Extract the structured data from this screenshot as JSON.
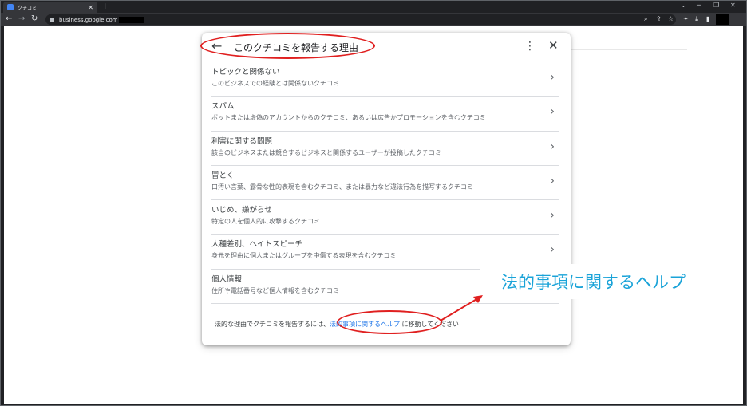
{
  "browser": {
    "tab_title": "クチコミ",
    "tab_close": "✕",
    "new_tab": "+",
    "url": "business.google.com",
    "window_controls": [
      "⌄",
      "─",
      "❐",
      "✕"
    ]
  },
  "dialog": {
    "title": "このクチコミを報告する理由",
    "reasons": [
      {
        "title": "トピックと関係ない",
        "desc": "このビジネスでの経験とは関係ないクチコミ",
        "has_chevron": true
      },
      {
        "title": "スパム",
        "desc": "ボットまたは虚偽のアカウントからのクチコミ、あるいは広告かプロモーションを含むクチコミ",
        "has_chevron": true
      },
      {
        "title": "利害に関する問題",
        "desc": "該当のビジネスまたは競合するビジネスと関係するユーザーが投稿したクチコミ",
        "has_chevron": true
      },
      {
        "title": "冒とく",
        "desc": "口汚い言葉、露骨な性的表現を含むクチコミ、または暴力など違法行為を描写するクチコミ",
        "has_chevron": true
      },
      {
        "title": "いじめ、嫌がらせ",
        "desc": "特定の人を個人的に攻撃するクチコミ",
        "has_chevron": true
      },
      {
        "title": "人種差別、ヘイトスピーチ",
        "desc": "身元を理由に個人またはグループを中傷する表現を含むクチコミ",
        "has_chevron": true
      },
      {
        "title": "個人情報",
        "desc": "住所や電話番号など個人情報を含むクチコミ",
        "has_chevron": false
      }
    ],
    "footer_before": "法的な理由でクチコミを報告するには、",
    "footer_link": "法的事項に関するヘルプ",
    "footer_after": " に移動してください"
  },
  "annotation": {
    "callout": "法的事項に関するヘルプ",
    "color": "#e02020",
    "callout_color": "#1aa3d8"
  }
}
